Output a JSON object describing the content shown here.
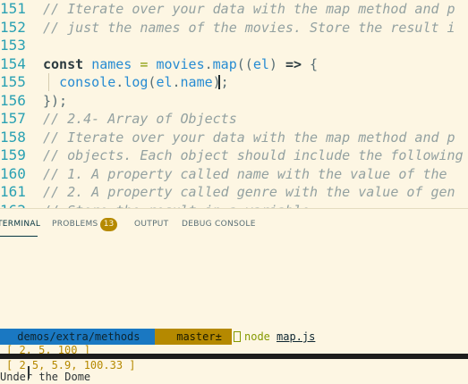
{
  "editor": {
    "lines": [
      {
        "num": "151",
        "text": "// Iterate over your data with the map method and p"
      },
      {
        "num": "152",
        "text": "// just the names of the movies. Store the result i"
      },
      {
        "num": "153",
        "text": ""
      },
      {
        "num": "154",
        "tokens": [
          {
            "t": "const",
            "c": "kw"
          },
          {
            "t": " ",
            "c": "plain"
          },
          {
            "t": "names",
            "c": "var"
          },
          {
            "t": " = ",
            "c": "op"
          },
          {
            "t": "movies",
            "c": "var"
          },
          {
            "t": ".",
            "c": "plain"
          },
          {
            "t": "map",
            "c": "fn"
          },
          {
            "t": "((",
            "c": "plain"
          },
          {
            "t": "el",
            "c": "var"
          },
          {
            "t": ") ",
            "c": "plain"
          },
          {
            "t": "=>",
            "c": "kw"
          },
          {
            "t": " {",
            "c": "plain"
          }
        ]
      },
      {
        "num": "155",
        "tokens": [
          {
            "t": "  ",
            "c": "plain"
          },
          {
            "t": "console",
            "c": "var"
          },
          {
            "t": ".",
            "c": "plain"
          },
          {
            "t": "log",
            "c": "fn"
          },
          {
            "t": "(",
            "c": "plain"
          },
          {
            "t": "el",
            "c": "var"
          },
          {
            "t": ".",
            "c": "plain"
          },
          {
            "t": "name",
            "c": "var"
          },
          {
            "t": ");",
            "c": "plain"
          }
        ]
      },
      {
        "num": "156",
        "text_plain": "});"
      },
      {
        "num": "157",
        "text": "// 2.4- Array of Objects"
      },
      {
        "num": "158",
        "text": "// Iterate over your data with the map method and p"
      },
      {
        "num": "159",
        "text": "// objects. Each object should include the following"
      },
      {
        "num": "160",
        "text": "// 1. A property called name with the value of the "
      },
      {
        "num": "161",
        "text": "// 2. A property called genre with the value of gen"
      },
      {
        "num": "162",
        "text": "// Store the result in a variable"
      }
    ]
  },
  "panel": {
    "tabs": {
      "terminal": "TERMINAL",
      "problems": "PROBLEMS",
      "problems_count": "13",
      "output": "OUTPUT",
      "debug_console": "DEBUG CONSOLE"
    },
    "terminal": {
      "prompt_dir": " demos/extra/methods",
      "prompt_branch": " master±",
      "command": "node",
      "command_file": "map.js",
      "output_lines": [
        "[ 2, 5, 100 ]",
        "[ 2.5, 5.9, 100.33 ]",
        "Under the Dome"
      ]
    }
  },
  "colors": {
    "background": "#fdf6e3",
    "line_numbers": "#2aa1b3",
    "comment": "#93a1a1",
    "variable": "#268bd2",
    "operator": "#859900",
    "badge": "#b58900",
    "prompt_dir_bg": "#1a78c2",
    "prompt_branch_bg": "#b58900"
  }
}
